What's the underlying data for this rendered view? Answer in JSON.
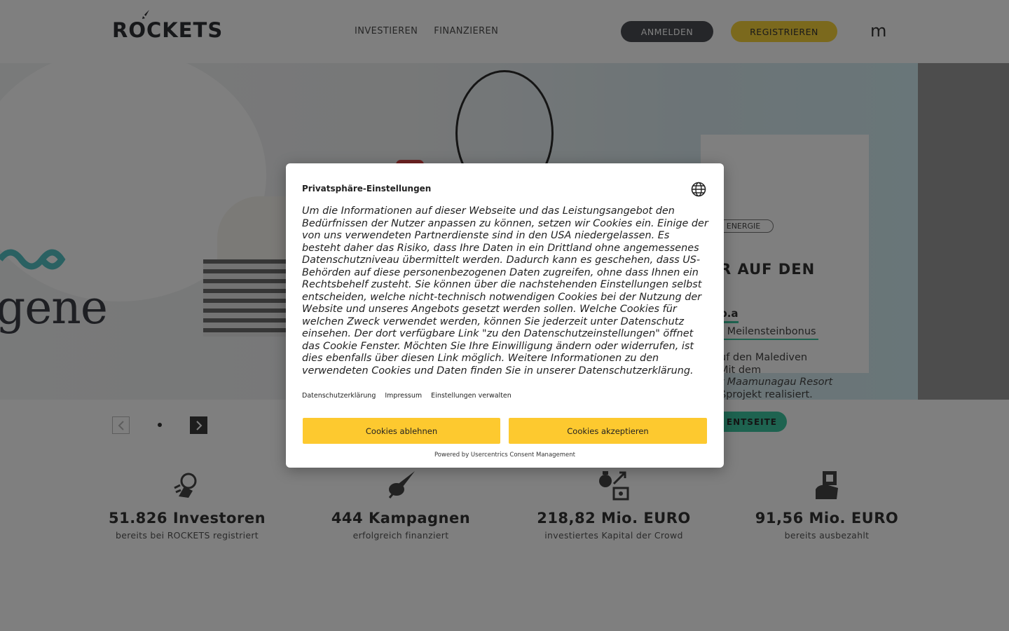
{
  "header": {
    "logo_text": "ROCKETS",
    "nav": [
      "INVESTIEREN",
      "FINANZIEREN"
    ],
    "login_label": "ANMELDEN",
    "register_label": "REGISTRIEREN",
    "menu_glyph": "m"
  },
  "hero": {
    "brand_word": "gene",
    "tag": "ENERGIE",
    "title": "R AUF DEN",
    "company": "p.a",
    "bonus": "r Meilensteinbonus",
    "desc_line1": "uf den Malediven",
    "desc_line2": "Mit dem",
    "desc_line3": "r Maamunagau Resort",
    "desc_line4": "ßprojekt realisiert.",
    "button": "ENTSEITE"
  },
  "stats": [
    {
      "number": "51.826 Investoren",
      "label": "bereits bei ROCKETS registriert",
      "icon": "astronaut-icon"
    },
    {
      "number": "444 Kampagnen",
      "label": "erfolgreich finanziert",
      "icon": "rocket-icon"
    },
    {
      "number": "218,82 Mio. EURO",
      "label": "investiertes Kapital der Crowd",
      "icon": "money-transfer-icon"
    },
    {
      "number": "91,56 Mio. EURO",
      "label": "bereits ausbezahlt",
      "icon": "payout-icon"
    }
  ],
  "consent": {
    "title": "Privatsphäre-Einstellungen",
    "body": "Um die Informationen auf dieser Webseite und das Leistungsangebot den Bedürfnissen der Nutzer anpassen zu können, setzen wir Cookies ein. Einige der von uns verwendeten Partnerdienste sind in den USA niedergelassen. Es besteht daher das Risiko, dass Ihre Daten in ein Drittland ohne angemessenes Datenschutzniveau übermittelt werden. Dadurch kann es geschehen, dass US-Behörden auf diese personenbezogenen Daten zugreifen, ohne dass Ihnen ein Rechtsbehelf zusteht. Sie können über die nachstehenden Einstellungen selbst entscheiden, welche nicht-technisch notwendigen Cookies bei der Nutzung der Website und unseres Angebots gesetzt werden sollen. Welche Cookies für welchen Zweck verwendet werden, können Sie jederzeit unter Datenschutz einsehen. Der dort verfügbare Link \"zu den Datenschutzeinstellungen\" öffnet das Cookie Fenster. Möchten Sie Ihre Einwilligung ändern oder widerrufen, ist dies ebenfalls über diesen Link möglich. Weitere Informationen zu den verwendeten Cookies und Daten finden Sie in unserer Datenschutzerklärung.",
    "links": [
      "Datenschutzerklärung",
      "Impressum",
      "Einstellungen verwalten"
    ],
    "decline_label": "Cookies ablehnen",
    "accept_label": "Cookies akzeptieren",
    "powered_by": "Powered by Usercentrics Consent Management"
  },
  "colors": {
    "accent_yellow": "#fdc92f",
    "accent_green": "#3cc7a0",
    "dark": "#4a4c52"
  }
}
